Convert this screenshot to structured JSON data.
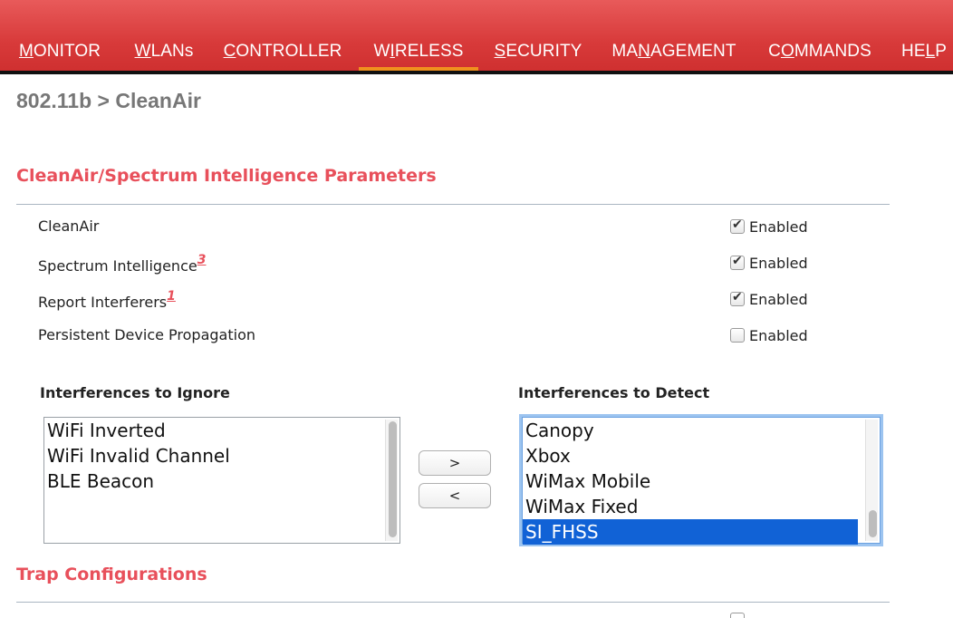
{
  "nav": {
    "items": [
      {
        "pre": "",
        "u": "M",
        "post": "ONITOR"
      },
      {
        "pre": "",
        "u": "W",
        "post": "LANs"
      },
      {
        "pre": "",
        "u": "C",
        "post": "ONTROLLER"
      },
      {
        "pre": "W",
        "u": "I",
        "post": "RELESS"
      },
      {
        "pre": "",
        "u": "S",
        "post": "ECURITY"
      },
      {
        "pre": "MA",
        "u": "N",
        "post": "AGEMENT"
      },
      {
        "pre": "C",
        "u": "O",
        "post": "MMANDS"
      },
      {
        "pre": "HE",
        "u": "L",
        "post": "P"
      }
    ],
    "active_index": 3,
    "active_color": "#f0901e"
  },
  "breadcrumb": "802.11b > CleanAir",
  "sections": {
    "params_title": "CleanAir/Spectrum Intelligence Parameters",
    "trap_title": "Trap Configurations"
  },
  "params": [
    {
      "label": "CleanAir",
      "note": "",
      "checked": true,
      "check_label": "Enabled"
    },
    {
      "label": "Spectrum Intelligence",
      "note": "3",
      "checked": true,
      "check_label": "Enabled"
    },
    {
      "label": "Report Interferers",
      "note": "1",
      "checked": true,
      "check_label": "Enabled"
    },
    {
      "label": "Persistent Device Propagation",
      "note": "",
      "checked": false,
      "check_label": "Enabled"
    }
  ],
  "ignore_list": {
    "title": "Interferences to Ignore",
    "options": [
      "WiFi Inverted",
      "WiFi Invalid Channel",
      "BLE Beacon"
    ]
  },
  "detect_list": {
    "title": "Interferences to Detect",
    "options": [
      "Canopy",
      "Xbox",
      "WiMax Mobile",
      "WiMax Fixed",
      "SI_FHSS"
    ],
    "selected": "SI_FHSS"
  },
  "buttons": {
    "add": ">",
    "remove": "<"
  },
  "colors": {
    "header_red": "#d83a3a",
    "section_red": "#e8505b",
    "selection_blue": "#1162d6"
  }
}
